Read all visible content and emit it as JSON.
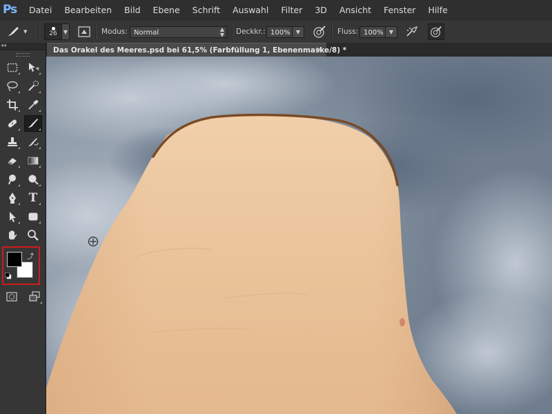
{
  "app": {
    "logo": "Ps"
  },
  "menu": {
    "items": [
      "Datei",
      "Bearbeiten",
      "Bild",
      "Ebene",
      "Schrift",
      "Auswahl",
      "Filter",
      "3D",
      "Ansicht",
      "Fenster",
      "Hilfe"
    ]
  },
  "options": {
    "brush_size": "26",
    "mode_label": "Modus:",
    "mode_value": "Normal",
    "opacity_label": "Deckkr.:",
    "opacity_value": "100%",
    "flow_label": "Fluss:",
    "flow_value": "100%"
  },
  "document": {
    "tab_title": "Das Orakel des Meeres.psd bei 61,5% (Farbfüllung 1, Ebenenmaske/8) *",
    "close_glyph": "×"
  },
  "colors": {
    "foreground": "#000000",
    "background": "#ffffff",
    "highlight": "#d01b1b",
    "ps_blue": "#7ab6ff"
  },
  "tools": [
    [
      "marquee-icon",
      "move-icon"
    ],
    [
      "lasso-icon",
      "quick-selection-icon"
    ],
    [
      "crop-icon",
      "eyedropper-icon"
    ],
    [
      "healing-brush-icon",
      "brush-icon"
    ],
    [
      "clone-stamp-icon",
      "history-brush-icon"
    ],
    [
      "eraser-icon",
      "gradient-icon"
    ],
    [
      "blur-icon",
      "dodge-icon"
    ],
    [
      "pen-icon",
      "type-icon"
    ],
    [
      "path-selection-icon",
      "shape-icon"
    ],
    [
      "hand-icon",
      "zoom-icon"
    ]
  ],
  "type_tool_glyph": "T"
}
